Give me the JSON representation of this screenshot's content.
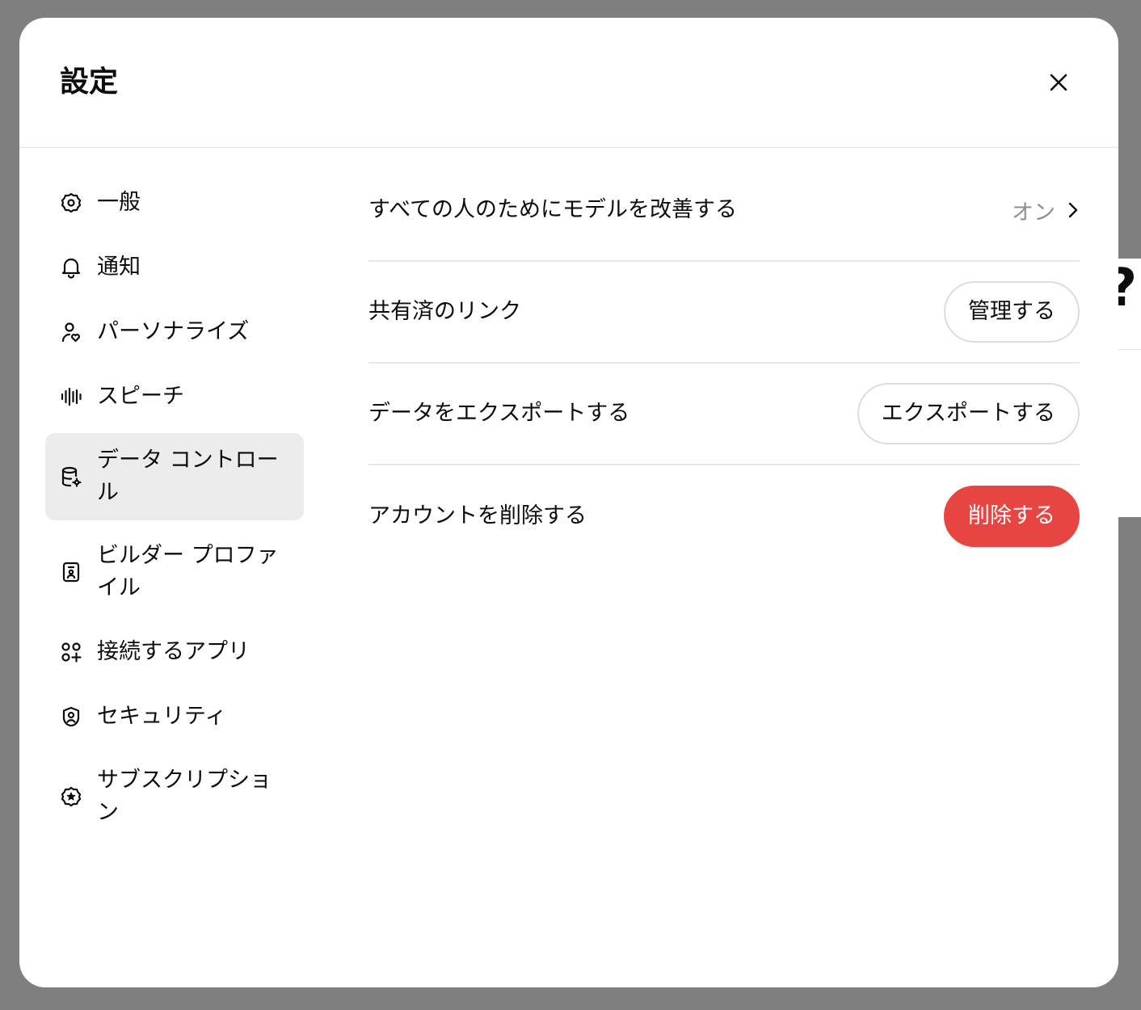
{
  "background": {
    "glyph": "?"
  },
  "modal": {
    "title": "設定"
  },
  "sidebar": {
    "items": [
      {
        "label": "一般",
        "icon": "gear-icon"
      },
      {
        "label": "通知",
        "icon": "bell-icon"
      },
      {
        "label": "パーソナライズ",
        "icon": "person-heart-icon"
      },
      {
        "label": "スピーチ",
        "icon": "waveform-icon"
      },
      {
        "label": "データ コントロール",
        "icon": "database-gear-icon",
        "active": true
      },
      {
        "label": "ビルダー プロファイル",
        "icon": "id-badge-icon"
      },
      {
        "label": "接続するアプリ",
        "icon": "apps-plus-icon"
      },
      {
        "label": "セキュリティ",
        "icon": "shield-user-icon"
      },
      {
        "label": "サブスクリプション",
        "icon": "badge-star-icon"
      }
    ]
  },
  "content": {
    "improve_model": {
      "label": "すべての人のためにモデルを改善する",
      "value": "オン"
    },
    "shared_links": {
      "label": "共有済のリンク",
      "button": "管理する"
    },
    "export_data": {
      "label": "データをエクスポートする",
      "button": "エクスポートする"
    },
    "delete_account": {
      "label": "アカウントを削除する",
      "button": "削除する"
    }
  },
  "colors": {
    "danger": "#e74541",
    "active_bg": "#ececec",
    "overlay": "#7f7f7f"
  }
}
